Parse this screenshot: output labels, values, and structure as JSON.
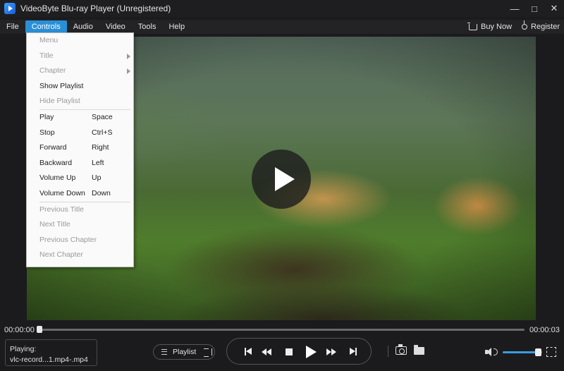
{
  "window": {
    "title": "VideoByte Blu-ray Player (Unregistered)",
    "min_glyph": "—",
    "max_glyph": "□",
    "close_glyph": "✕"
  },
  "menubar": {
    "items": [
      {
        "label": "File"
      },
      {
        "label": "Controls",
        "active": true
      },
      {
        "label": "Audio"
      },
      {
        "label": "Video"
      },
      {
        "label": "Tools"
      },
      {
        "label": "Help"
      }
    ],
    "buy_now": "Buy Now",
    "register": "Register"
  },
  "controls_menu": {
    "items": [
      {
        "label": "Menu",
        "shortcut": "",
        "disabled": true,
        "submenu": false
      },
      {
        "label": "Title",
        "shortcut": "",
        "disabled": true,
        "submenu": true
      },
      {
        "label": "Chapter",
        "shortcut": "",
        "disabled": true,
        "submenu": true
      },
      {
        "label": "Show Playlist",
        "shortcut": "",
        "disabled": false,
        "submenu": false
      },
      {
        "label": "Hide Playlist",
        "shortcut": "",
        "disabled": true,
        "submenu": false
      },
      {
        "label": "Play",
        "shortcut": "Space",
        "disabled": false,
        "submenu": false
      },
      {
        "label": "Stop",
        "shortcut": "Ctrl+S",
        "disabled": false,
        "submenu": false
      },
      {
        "label": "Forward",
        "shortcut": "Right",
        "disabled": false,
        "submenu": false
      },
      {
        "label": "Backward",
        "shortcut": "Left",
        "disabled": false,
        "submenu": false
      },
      {
        "label": "Volume Up",
        "shortcut": "Up",
        "disabled": false,
        "submenu": false
      },
      {
        "label": "Volume Down",
        "shortcut": "Down",
        "disabled": false,
        "submenu": false
      },
      {
        "label": "Previous Title",
        "shortcut": "",
        "disabled": true,
        "submenu": false
      },
      {
        "label": "Next Title",
        "shortcut": "",
        "disabled": true,
        "submenu": false
      },
      {
        "label": "Previous Chapter",
        "shortcut": "",
        "disabled": true,
        "submenu": false
      },
      {
        "label": "Next Chapter",
        "shortcut": "",
        "disabled": true,
        "submenu": false
      }
    ]
  },
  "player": {
    "current_time": "00:00:00",
    "total_time": "00:00:03",
    "progress_fraction": 0.0,
    "playing_label": "Playing:",
    "playing_file": "vlc-record...1.mp4-.mp4",
    "playlist_label": "Playlist",
    "volume_fraction": 0.9
  },
  "colors": {
    "accent": "#2a8fd6",
    "progress": "#3a9be0"
  }
}
